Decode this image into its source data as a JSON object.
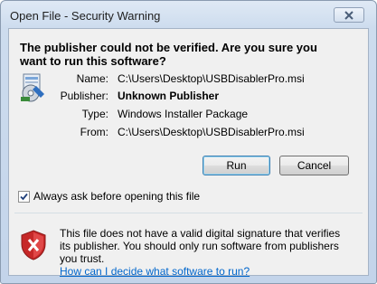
{
  "window": {
    "title": "Open File - Security Warning",
    "close_icon": "close-icon"
  },
  "headline": "The publisher could not be verified.  Are you sure you want to run this software?",
  "details": {
    "name_label": "Name:",
    "name_value": "C:\\Users\\Desktop\\USBDisablerPro.msi",
    "publisher_label": "Publisher:",
    "publisher_value": "Unknown Publisher",
    "type_label": "Type:",
    "type_value": "Windows Installer Package",
    "from_label": "From:",
    "from_value": "C:\\Users\\Desktop\\USBDisablerPro.msi"
  },
  "buttons": {
    "run": "Run",
    "cancel": "Cancel"
  },
  "checkbox": {
    "label": "Always ask before opening this file",
    "checked": true
  },
  "warning": {
    "text": "This file does not have a valid digital signature that verifies its publisher.  You should only run software from publishers you trust.",
    "link": "How can I decide what software to run?"
  },
  "colors": {
    "link": "#0066cc",
    "shield": "#c62828"
  }
}
